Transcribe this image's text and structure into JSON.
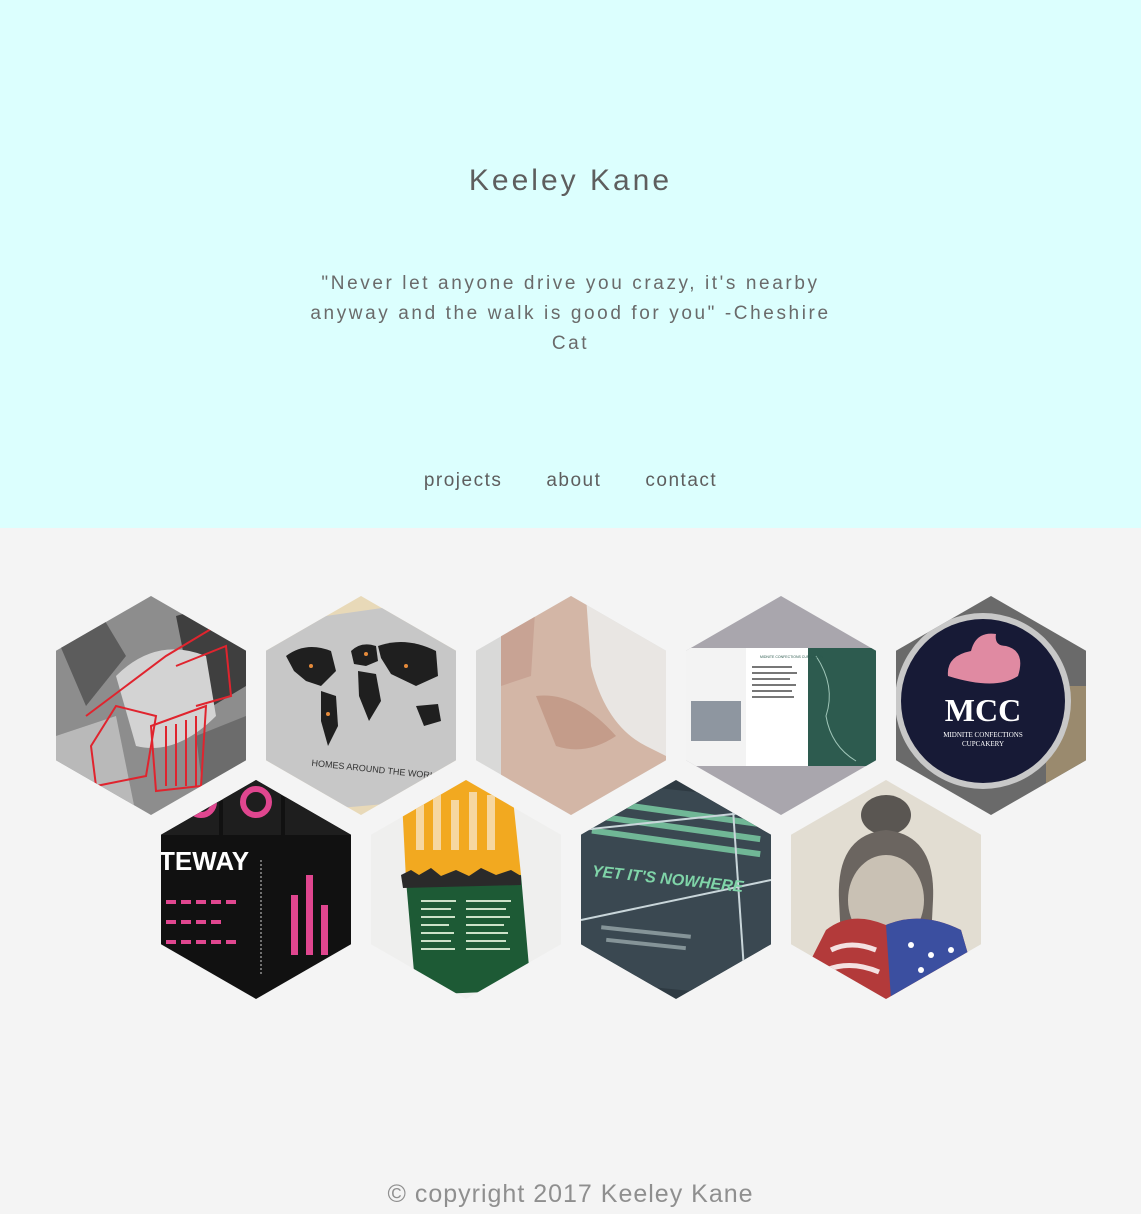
{
  "header": {
    "title": "Keeley Kane",
    "quote": "\"Never let anyone drive you crazy, it's nearby anyway and the walk is good for you\" -Cheshire Cat",
    "background": "#dcfffe"
  },
  "nav": {
    "items": [
      {
        "label": "projects"
      },
      {
        "label": "about"
      },
      {
        "label": "contact"
      }
    ]
  },
  "projects": [
    {
      "id": "line-portrait",
      "name": "project-tile-line-portrait"
    },
    {
      "id": "homes-around-the-world",
      "name": "project-tile-world-map",
      "caption": "HOMES AROUND THE WORLD"
    },
    {
      "id": "shoulder-photo",
      "name": "project-tile-shoulder-photo"
    },
    {
      "id": "midnite-brochure",
      "name": "project-tile-brochure",
      "caption": "MIDNITE CONFECTIONS CUPCAKERY"
    },
    {
      "id": "mcc-sign",
      "name": "project-tile-mcc-logo",
      "logo_text": "MCC",
      "logo_subtext": "MIDNITE CONFECTIONS",
      "logo_subtext2": "CUPCAKERY"
    },
    {
      "id": "gateway-infographic",
      "name": "project-tile-infographic",
      "caption": "TEWAY"
    },
    {
      "id": "typography-poster",
      "name": "project-tile-poster"
    },
    {
      "id": "opportunity-nowhere",
      "name": "project-tile-typography-lines",
      "caption": "YET IT'S NOWHERE"
    },
    {
      "id": "flag-drawing",
      "name": "project-tile-flag-drawing"
    }
  ],
  "footer": {
    "copyright": "© copyright 2017 Keeley Kane"
  }
}
